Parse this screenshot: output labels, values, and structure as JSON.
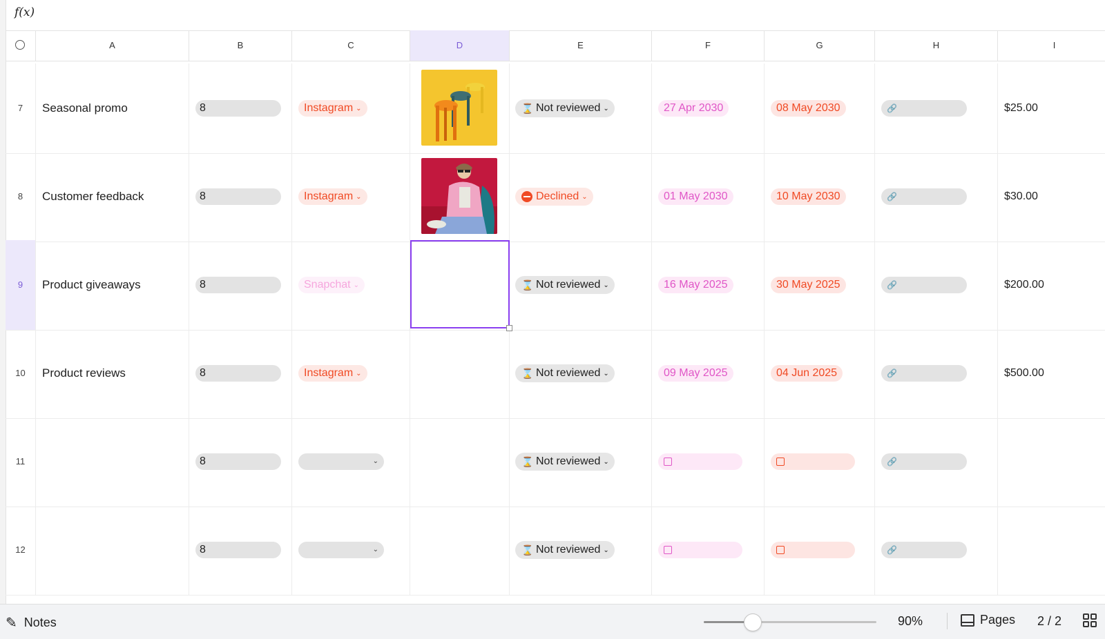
{
  "formula_bar": {
    "fx_label": "f(x)"
  },
  "columns": [
    "A",
    "B",
    "C",
    "D",
    "E",
    "F",
    "G",
    "H",
    "I"
  ],
  "active_column": "D",
  "rows": [
    {
      "num": "7",
      "a": "Seasonal promo",
      "b": "8",
      "channel": "Instagram",
      "image": "orange-stools",
      "status": "Not reviewed",
      "f_date": "27 Apr 2030",
      "g_date": "08 May 2030",
      "price": "$25.00"
    },
    {
      "num": "8",
      "a": "Customer feedback",
      "b": "8",
      "channel": "Instagram",
      "image": "person-pink-jacket",
      "status": "Declined",
      "f_date": "01 May 2030",
      "g_date": "10 May 2030",
      "price": "$30.00"
    },
    {
      "num": "9",
      "a": "Product giveaways",
      "b": "8",
      "channel": "Snapchat",
      "image": "",
      "status": "Not reviewed",
      "f_date": "16 May 2025",
      "g_date": "30 May 2025",
      "price": "$200.00"
    },
    {
      "num": "10",
      "a": "Product reviews",
      "b": "8",
      "channel": "Instagram",
      "image": "",
      "status": "Not reviewed",
      "f_date": "09 May 2025",
      "g_date": "04 Jun 2025",
      "price": "$500.00"
    },
    {
      "num": "11",
      "a": "",
      "b": "8",
      "channel": "",
      "image": "",
      "status": "Not reviewed",
      "f_date": "",
      "g_date": "",
      "price": ""
    },
    {
      "num": "12",
      "a": "",
      "b": "8",
      "channel": "",
      "image": "",
      "status": "Not reviewed",
      "f_date": "",
      "g_date": "",
      "price": ""
    }
  ],
  "active_row": "9",
  "bottom_bar": {
    "notes_label": "Notes",
    "zoom": "90%",
    "zoom_fraction": 0.28,
    "pages_label": "Pages",
    "page_count": "2 / 2"
  },
  "colors": {
    "accent": "#8a3ff0",
    "channel": "#f04a24",
    "start_date": "#e056c7",
    "end_date": "#f04a24"
  }
}
